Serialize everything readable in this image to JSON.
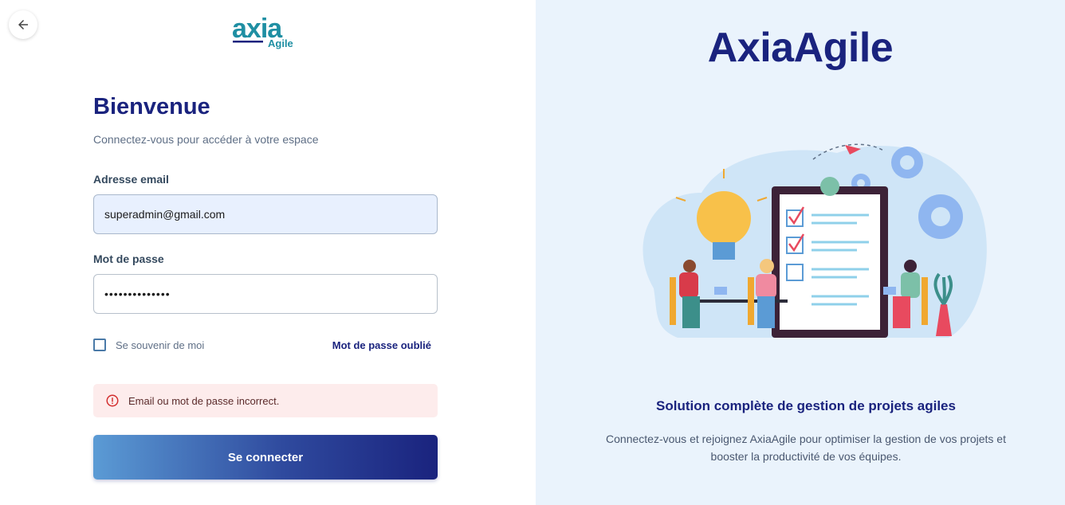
{
  "logo": {
    "main": "axia",
    "sub": "Agile"
  },
  "form": {
    "title": "Bienvenue",
    "subtitle": "Connectez-vous pour accéder à votre espace",
    "email_label": "Adresse email",
    "email_value": "superadmin@gmail.com",
    "password_label": "Mot de passe",
    "password_value": "••••••••••••••",
    "remember_label": "Se souvenir de moi",
    "remember_checked": false,
    "forgot_label": "Mot de passe oublié",
    "error_message": "Email ou mot de passe incorrect.",
    "submit_label": "Se connecter"
  },
  "hero": {
    "brand": "AxiaAgile",
    "tagline": "Solution complète de gestion de projets agiles",
    "description": "Connectez-vous et rejoignez AxiaAgile pour optimiser la gestion de vos projets et booster la productivité de vos équipes."
  },
  "icons": {
    "back": "arrow-left-icon",
    "error": "alert-circle-icon"
  },
  "colors": {
    "primary": "#1a237e",
    "accent": "#5b9bd5",
    "right_panel_bg": "#eaf3fc",
    "error_bg": "#fdecec",
    "error_icon": "#d32f2f",
    "input_autofill_bg": "#e8f0fe",
    "logo_teal": "#1f8fa3"
  }
}
